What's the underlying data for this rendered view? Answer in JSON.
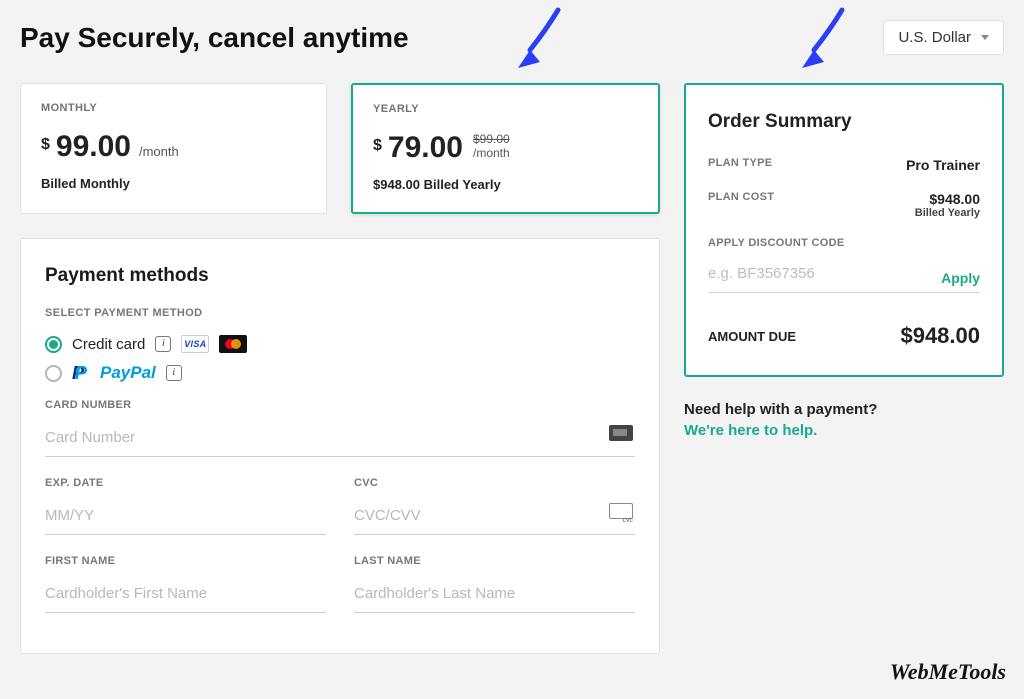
{
  "headline": "Pay Securely, cancel anytime",
  "currency": {
    "selected": "U.S. Dollar"
  },
  "plans": {
    "monthly": {
      "label": "MONTHLY",
      "price": "99.00",
      "per": "/month",
      "note": "Billed Monthly"
    },
    "yearly": {
      "label": "YEARLY",
      "price": "79.00",
      "per": "/month",
      "strike": "$99.00",
      "note": "$948.00 Billed Yearly"
    }
  },
  "payment": {
    "heading": "Payment methods",
    "select_label": "SELECT PAYMENT METHOD",
    "credit_card_label": "Credit card",
    "paypal_label_a": "Pay",
    "paypal_label_b": "Pal",
    "card_number_label": "CARD NUMBER",
    "card_number_ph": "Card Number",
    "exp_label": "EXP. DATE",
    "exp_ph": "MM/YY",
    "cvc_label": "CVC",
    "cvc_ph": "CVC/CVV",
    "first_name_label": "FIRST NAME",
    "first_name_ph": "Cardholder's First Name",
    "last_name_label": "LAST NAME",
    "last_name_ph": "Cardholder's Last Name"
  },
  "summary": {
    "title": "Order Summary",
    "plan_type_label": "PLAN TYPE",
    "plan_type_value": "Pro Trainer",
    "plan_cost_label": "PLAN COST",
    "plan_cost_value": "$948.00",
    "plan_cost_sub": "Billed Yearly",
    "discount_label": "APPLY DISCOUNT CODE",
    "discount_ph": "e.g. BF3567356",
    "apply_label": "Apply",
    "amount_due_label": "AMOUNT DUE",
    "amount_due_value": "$948.00"
  },
  "help": {
    "q": "Need help with a payment?",
    "a": "We're here to help."
  },
  "watermark": "WebMeTools"
}
